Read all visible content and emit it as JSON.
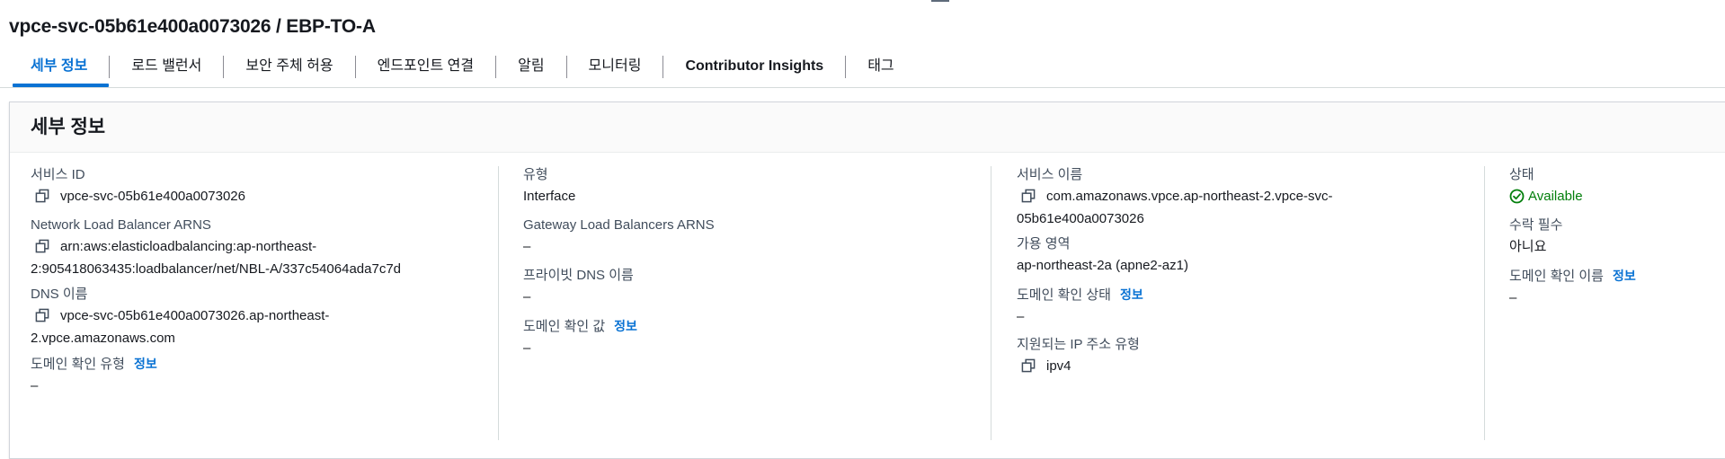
{
  "page": {
    "title": "vpce-svc-05b61e400a0073026 / EBP-TO-A"
  },
  "tabs": [
    {
      "label": "세부 정보"
    },
    {
      "label": "로드 밸런서"
    },
    {
      "label": "보안 주체 허용"
    },
    {
      "label": "엔드포인트 연결"
    },
    {
      "label": "알림"
    },
    {
      "label": "모니터링"
    },
    {
      "label": "Contributor Insights"
    },
    {
      "label": "태그"
    }
  ],
  "details": {
    "title": "세부 정보",
    "info_link": "정보",
    "service_id": {
      "label": "서비스 ID",
      "value": "vpce-svc-05b61e400a0073026"
    },
    "nlb_arns": {
      "label": "Network Load Balancer ARNS",
      "value_line1": "arn:aws:elasticloadbalancing:ap-northeast-",
      "value_line2": "2:905418063435:loadbalancer/net/NBL-A/337c54064ada7c7d"
    },
    "dns_name": {
      "label": "DNS 이름",
      "value_line1": "vpce-svc-05b61e400a0073026.ap-northeast-",
      "value_line2": "2.vpce.amazonaws.com"
    },
    "domain_verification_type": {
      "label": "도메인 확인 유형",
      "value": "–"
    },
    "type": {
      "label": "유형",
      "value": "Interface"
    },
    "gwlb_arns": {
      "label": "Gateway Load Balancers ARNS",
      "value": "–"
    },
    "private_dns_name": {
      "label": "프라이빗 DNS 이름",
      "value": "–"
    },
    "domain_verification_value": {
      "label": "도메인 확인 값",
      "value": "–"
    },
    "service_name": {
      "label": "서비스 이름",
      "value_line1": "com.amazonaws.vpce.ap-northeast-2.vpce-svc-",
      "value_line2": "05b61e400a0073026"
    },
    "availability_zones": {
      "label": "가용 영역",
      "value": "ap-northeast-2a (apne2-az1)"
    },
    "domain_verification_status": {
      "label": "도메인 확인 상태",
      "value": "–"
    },
    "supported_ip_types": {
      "label": "지원되는 IP 주소 유형",
      "value": "ipv4"
    },
    "state": {
      "label": "상태",
      "value": "Available",
      "color": "#037f0c"
    },
    "acceptance_required": {
      "label": "수락 필수",
      "value": "아니요"
    },
    "domain_verification_name": {
      "label": "도메인 확인 이름",
      "value": "–"
    }
  },
  "colors": {
    "accent": "#0972d3",
    "success": "#037f0c"
  },
  "icons": {
    "copy": "copy-icon",
    "status": "status-positive-icon"
  }
}
